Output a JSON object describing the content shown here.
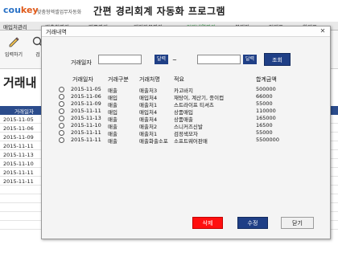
{
  "app": {
    "logo_part1": "cou",
    "logo_part2": "key",
    "logo_sub": "맞춤형엑셀업무자동화",
    "title": "간편 경리회계 자동화 프로그램"
  },
  "menu": {
    "items": [
      "매입처관리",
      "매출처관리",
      "제품관리",
      "계정과목관리",
      "거래내역관리",
      "분개장",
      "일계표",
      "합계표"
    ],
    "active_index": 4
  },
  "toolbar": {
    "buttons": [
      {
        "label": "입력하기",
        "icon": "pencil-icon"
      },
      {
        "label": "검",
        "icon": "search-icon"
      }
    ]
  },
  "page": {
    "heading": "거래내",
    "table_header": "거래일자",
    "dates": [
      "2015-11-05",
      "2015-11-06",
      "2015-11-09",
      "2015-11-11",
      "2015-11-13",
      "2015-11-10",
      "2015-11-11",
      "2015-11-11"
    ]
  },
  "dialog": {
    "title": "거래내역",
    "close_glyph": "✕",
    "filter": {
      "label": "거래일자",
      "from_value": "",
      "to_value": "",
      "calendar_label": "달력",
      "tilde": "~",
      "search_label": "조회"
    },
    "columns": [
      "거래일자",
      "거래구분",
      "거래처명",
      "적요",
      "합계금액"
    ],
    "rows": [
      {
        "date": "2015-11-05",
        "type": "매출",
        "partner": "매출처3",
        "memo": "카고바지",
        "amount": "500000"
      },
      {
        "date": "2015-11-06",
        "type": "매입",
        "partner": "매입처4",
        "memo": "재탕이, 계산기, 종이컵",
        "amount": "66000"
      },
      {
        "date": "2015-11-09",
        "type": "매출",
        "partner": "매출처1",
        "memo": "스트라이프 티셔츠",
        "amount": "55000"
      },
      {
        "date": "2015-11-11",
        "type": "매입",
        "partner": "매입처4",
        "memo": "상품매입",
        "amount": "110000"
      },
      {
        "date": "2015-11-13",
        "type": "매출",
        "partner": "매출처4",
        "memo": "상품매출",
        "amount": "165000"
      },
      {
        "date": "2015-11-10",
        "type": "매출",
        "partner": "매출처2",
        "memo": "스니커즈신발",
        "amount": "16500"
      },
      {
        "date": "2015-11-11",
        "type": "매출",
        "partner": "매출처1",
        "memo": "검정색모자",
        "amount": "55000"
      },
      {
        "date": "2015-11-11",
        "type": "매출",
        "partner": "매출화출소포",
        "memo": "소프트웨어판매",
        "amount": "5500000"
      }
    ],
    "buttons": {
      "delete": "삭제",
      "edit": "수정",
      "close": "닫기"
    }
  },
  "colors": {
    "navy": "#1f3f86",
    "delete_red": "#ff0f0f",
    "active_menu_green": "#1a8f2e",
    "logo_blue": "#2a72c6",
    "logo_orange": "#e05a1a"
  }
}
